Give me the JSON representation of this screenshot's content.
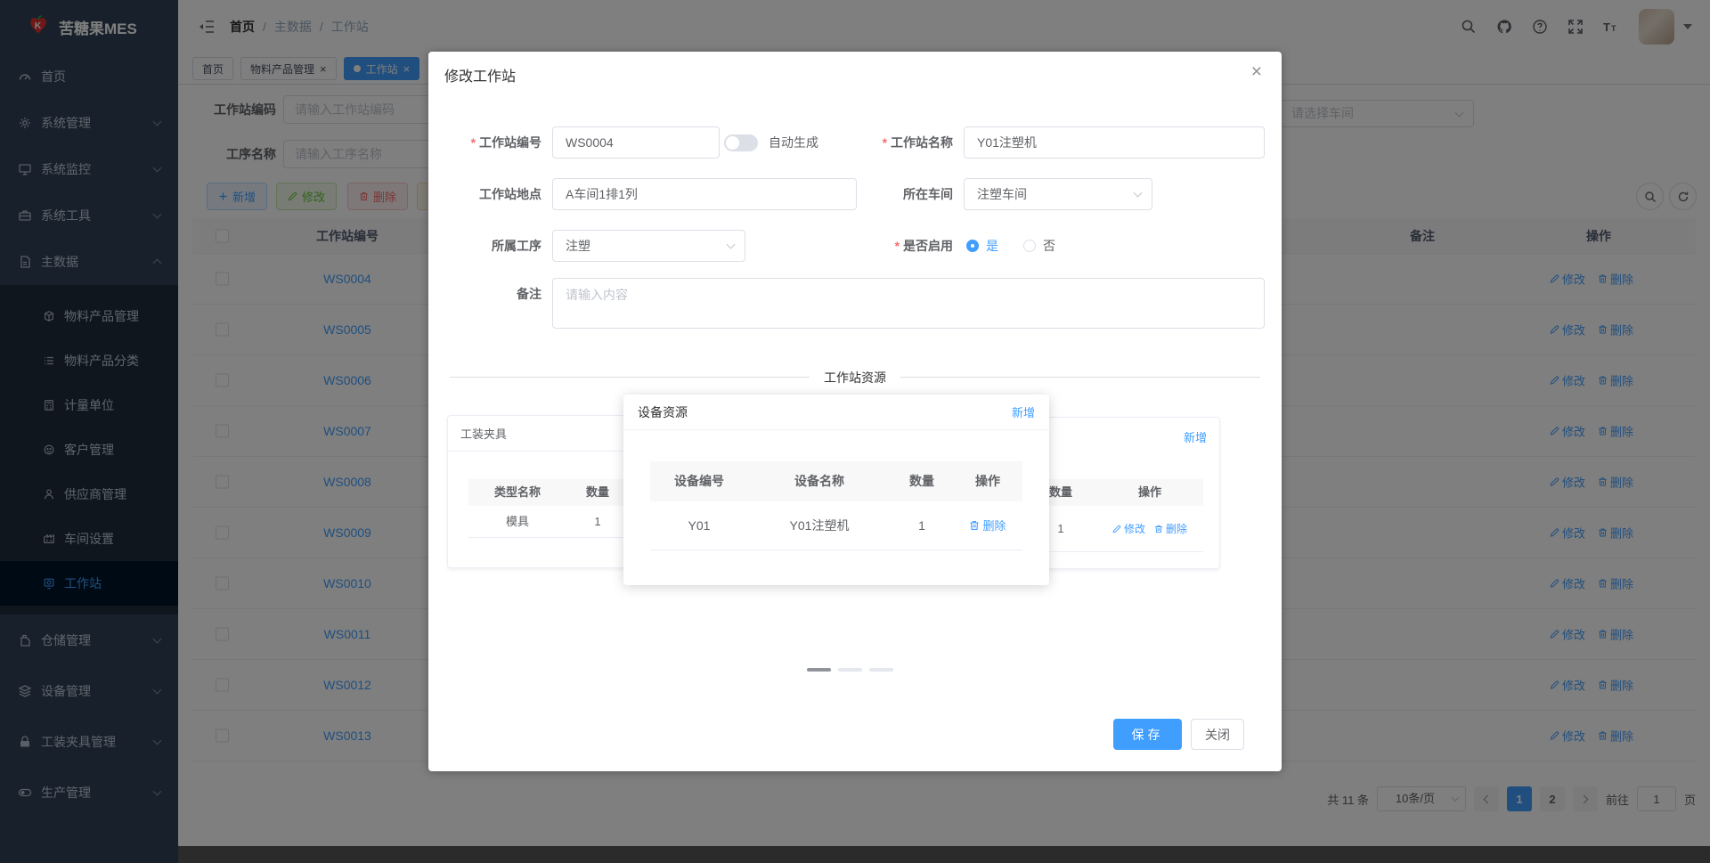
{
  "colors": {
    "accent": "#409eff",
    "success": "#67c23a",
    "danger": "#f56c6c",
    "warning": "#e6a23c",
    "sidebar_bg": "#304156",
    "submenu_bg": "#1f2d3d"
  },
  "app": {
    "title": "苦糖果MES"
  },
  "breadcrumb": {
    "separator": "/",
    "items": [
      "首页",
      "主数据",
      "工作站"
    ]
  },
  "tabs": [
    {
      "label": "首页",
      "closable": false,
      "active": false
    },
    {
      "label": "物料产品管理",
      "closable": true,
      "active": false
    },
    {
      "label": "工作站",
      "closable": true,
      "active": true
    }
  ],
  "sidebar": {
    "menu_top": [
      {
        "label": "首页",
        "icon": "dashboard-icon"
      },
      {
        "label": "系统管理",
        "icon": "gear-icon",
        "chevron": "down"
      },
      {
        "label": "系统监控",
        "icon": "monitor-icon",
        "chevron": "down"
      },
      {
        "label": "系统工具",
        "icon": "toolbox-icon",
        "chevron": "down"
      },
      {
        "label": "主数据",
        "icon": "document-icon",
        "chevron": "up",
        "expanded": true
      }
    ],
    "submenu": [
      {
        "label": "物料产品管理",
        "icon": "product-icon",
        "active": false
      },
      {
        "label": "物料产品分类",
        "icon": "category-icon",
        "active": false
      },
      {
        "label": "计量单位",
        "icon": "unit-icon",
        "active": false
      },
      {
        "label": "客户管理",
        "icon": "customer-icon",
        "active": false
      },
      {
        "label": "供应商管理",
        "icon": "supplier-icon",
        "active": false
      },
      {
        "label": "车间设置",
        "icon": "workshop-icon",
        "active": false
      },
      {
        "label": "工作站",
        "icon": "workstation-icon",
        "active": true
      }
    ],
    "menu_bottom": [
      {
        "label": "仓储管理",
        "icon": "warehouse-icon",
        "chevron": "down"
      },
      {
        "label": "设备管理",
        "icon": "device-icon",
        "chevron": "down"
      },
      {
        "label": "工装夹具管理",
        "icon": "lock-icon",
        "chevron": "down"
      },
      {
        "label": "生产管理",
        "icon": "production-icon",
        "chevron": "down"
      }
    ]
  },
  "search": {
    "code_label": "工作站编码",
    "code_placeholder": "请输入工作站编码",
    "process_label": "工序名称",
    "process_placeholder": "请输入工序名称",
    "workshop_placeholder": "请选择车间"
  },
  "toolbar": {
    "add": "新增",
    "edit": "修改",
    "delete": "删除"
  },
  "table": {
    "header": {
      "code": "工作站编号",
      "remark": "备注",
      "action": "操作"
    },
    "action_edit": "修改",
    "action_delete": "删除",
    "rows": [
      {
        "code": "WS0004"
      },
      {
        "code": "WS0005"
      },
      {
        "code": "WS0006"
      },
      {
        "code": "WS0007"
      },
      {
        "code": "WS0008"
      },
      {
        "code": "WS0009"
      },
      {
        "code": "WS0010"
      },
      {
        "code": "WS0011"
      },
      {
        "code": "WS0012"
      },
      {
        "code": "WS0013"
      }
    ]
  },
  "pagination": {
    "total": "共 11 条",
    "page_size": "10条/页",
    "page1": "1",
    "page2": "2",
    "active_page": "1",
    "goto": "前往",
    "goto_value": "1",
    "unit": "页"
  },
  "dialog": {
    "title": "修改工作站",
    "code_label": "工作站编号",
    "code_value": "WS0004",
    "auto_generate": "自动生成",
    "name_label": "工作站名称",
    "name_value": "Y01注塑机",
    "location_label": "工作站地点",
    "location_value": "A车间1排1列",
    "workshop_label": "所在车间",
    "workshop_value": "注塑车间",
    "process_label": "所属工序",
    "process_value": "注塑",
    "enabled_label": "是否启用",
    "enabled_yes": "是",
    "enabled_no": "否",
    "enabled_selected": "是",
    "remark_label": "备注",
    "remark_placeholder": "请输入内容",
    "section_title": "工作站资源",
    "fixture_card": {
      "title": "工装夹具",
      "col_type": "类型名称",
      "col_qty": "数量",
      "row_type": "模具",
      "row_qty": "1"
    },
    "device_panel": {
      "title": "设备资源",
      "add": "新增",
      "col_code": "设备编号",
      "col_name": "设备名称",
      "col_qty": "数量",
      "col_action": "操作",
      "row_code": "Y01",
      "row_name": "Y01注塑机",
      "row_qty": "1",
      "row_delete": "删除"
    },
    "staff_card": {
      "add": "新增",
      "col_qty": "数量",
      "col_action": "操作",
      "row_qty": "1",
      "row_edit": "修改",
      "row_delete": "删除"
    },
    "save": "保存",
    "close": "关闭"
  }
}
